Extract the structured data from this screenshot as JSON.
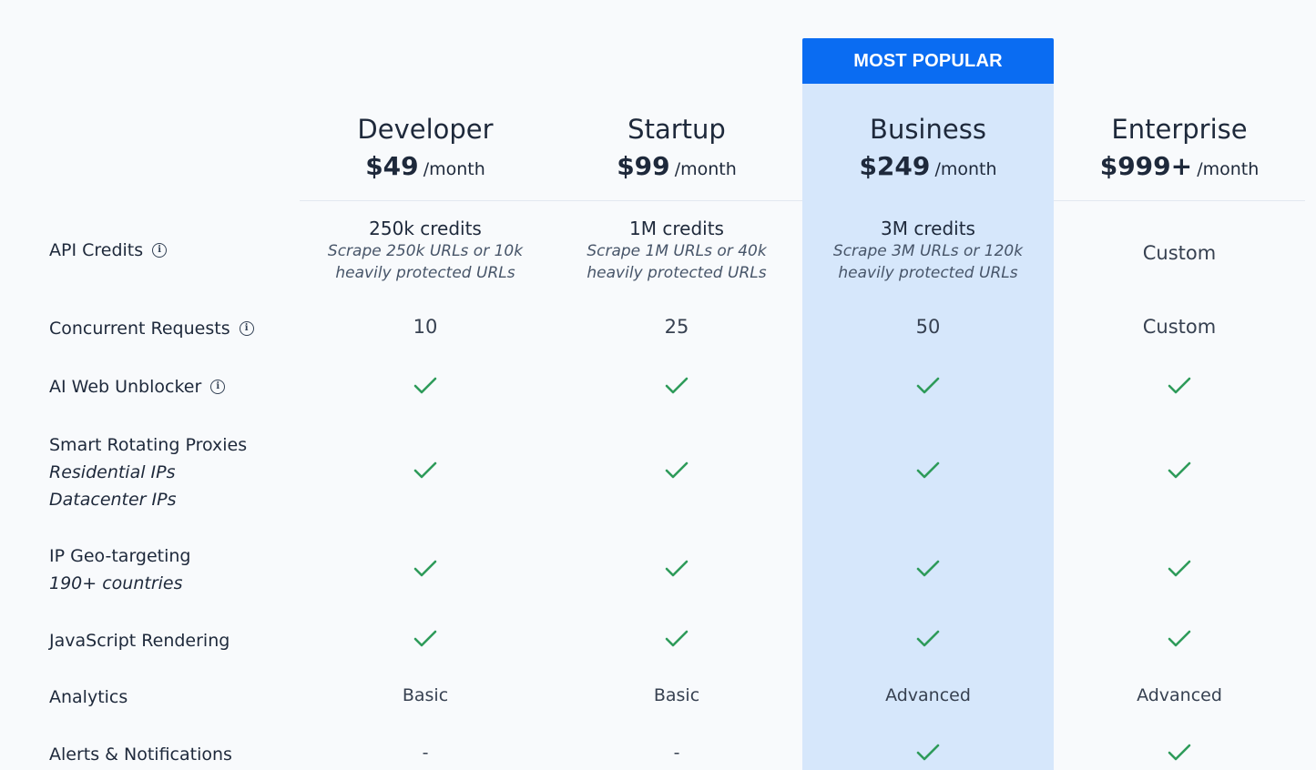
{
  "badge": "MOST POPULAR",
  "plans": [
    {
      "name": "Developer",
      "price": "$49",
      "period": "/month"
    },
    {
      "name": "Startup",
      "price": "$99",
      "period": "/month"
    },
    {
      "name": "Business",
      "price": "$249",
      "period": "/month"
    },
    {
      "name": "Enterprise",
      "price": "$999+",
      "period": "/month"
    }
  ],
  "rows": {
    "api_credits": {
      "label": "API Credits",
      "cells": [
        {
          "main": "250k credits",
          "note1": "Scrape 250k URLs or 10k",
          "note2": "heavily protected URLs"
        },
        {
          "main": "1M credits",
          "note1": "Scrape 1M URLs or 40k",
          "note2": "heavily protected URLs"
        },
        {
          "main": "3M credits",
          "note1": "Scrape 3M URLs or 120k",
          "note2": "heavily protected URLs"
        },
        {
          "text": "Custom"
        }
      ]
    },
    "concurrent": {
      "label": "Concurrent Requests",
      "cells": [
        "10",
        "25",
        "50",
        "Custom"
      ]
    },
    "unblocker": {
      "label": "AI Web Unblocker"
    },
    "proxies": {
      "label": "Smart Rotating Proxies",
      "sub1": "Residential IPs",
      "sub2": "Datacenter IPs"
    },
    "geo": {
      "label": "IP Geo-targeting",
      "sub1": "190+ countries"
    },
    "js": {
      "label": "JavaScript Rendering"
    },
    "analytics": {
      "label": "Analytics",
      "cells": [
        "Basic",
        "Basic",
        "Advanced",
        "Advanced"
      ]
    },
    "alerts": {
      "label": "Alerts & Notifications",
      "cells": [
        "-",
        "-"
      ]
    }
  },
  "icons": {
    "check": "check-icon",
    "info": "info-icon"
  },
  "colors": {
    "accent": "#0a6cf2",
    "highlight": "#d6e7fb",
    "check": "#2e9b5a"
  }
}
